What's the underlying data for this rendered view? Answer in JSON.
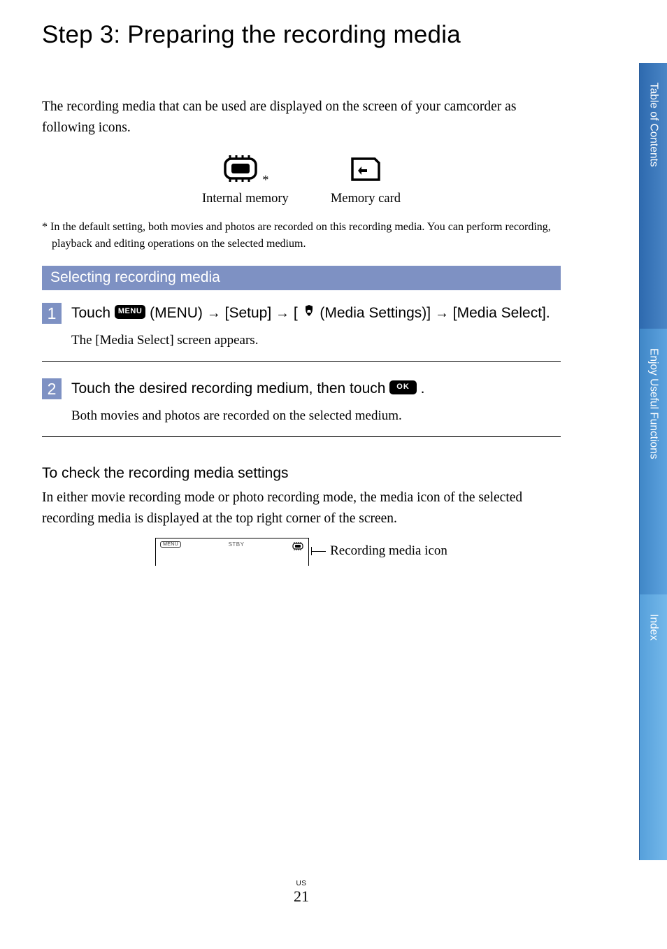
{
  "title": "Step 3: Preparing the recording media",
  "intro": "The recording media that can be used are displayed on the screen of your camcorder as following icons.",
  "media": {
    "internal": "Internal memory",
    "card": "Memory card",
    "star": "*"
  },
  "footnote": "*  In the default setting, both movies and photos are recorded on this recording media. You can perform recording, playback and editing operations on the selected medium.",
  "section": "Selecting recording media",
  "step1": {
    "num": "1",
    "pre": "Touch ",
    "menu_label": " (MENU) ",
    "arrow": "→",
    "setup": " [Setup] ",
    "media_settings": " (Media Settings)] ",
    "media_select": " [Media Select].",
    "sub": "The [Media Select] screen appears."
  },
  "step2": {
    "num": "2",
    "pre": "Touch the desired recording medium, then touch ",
    "post": ".",
    "sub": "Both movies and photos are recorded on the selected medium."
  },
  "subhead": "To check the recording media settings",
  "para": "In either movie recording mode or photo recording mode, the media icon of the selected recording media is displayed at the top right corner of the screen.",
  "lcd": {
    "menu": "MENU",
    "stby": "STBY",
    "callout": "Recording media icon"
  },
  "badges": {
    "menu": "MENU",
    "ok": "OK"
  },
  "tabs": {
    "toc": "Table of Contents",
    "useful": "Enjoy Useful Functions",
    "index": "Index"
  },
  "page": {
    "region": "US",
    "num": "21"
  }
}
